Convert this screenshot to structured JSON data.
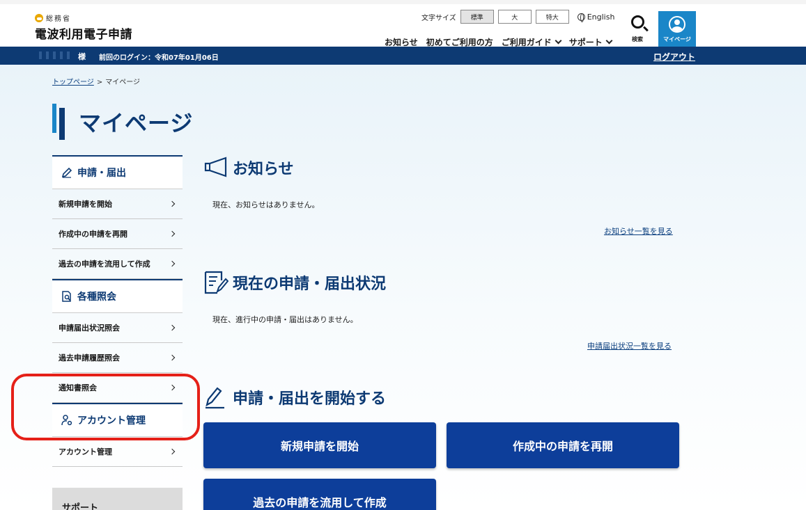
{
  "header": {
    "logo_small": "総務省",
    "logo_title": "電波利用電子申請",
    "fontsize_label": "文字サイズ",
    "fontsize_options": [
      "標準",
      "大",
      "特大"
    ],
    "language": "English",
    "nav": [
      "お知らせ",
      "初めてご利用の方",
      "ご利用ガイド",
      "サポート"
    ],
    "search_label": "検索",
    "mypage_label": "マイページ"
  },
  "userbar": {
    "name_suffix": "様",
    "last_login": "前回のログイン：令和07年01月06日",
    "logout": "ログアウト"
  },
  "breadcrumb": {
    "home": "トップページ",
    "separator": ">",
    "current": "マイページ"
  },
  "page_title": "マイページ",
  "sidebar": {
    "apply_head": "申請・届出",
    "apply_items": [
      "新規申請を開始",
      "作成中の申請を再開",
      "過去の申請を流用して作成"
    ],
    "inquiry_head": "各種照会",
    "inquiry_items": [
      "申請届出状況照会",
      "過去申請履歴照会",
      "通知書照会"
    ],
    "account_head": "アカウント管理",
    "account_items": [
      "アカウント管理"
    ],
    "support": "サポート"
  },
  "notice": {
    "title": "お知らせ",
    "text": "現在、お知らせはありません。",
    "link": "お知らせ一覧を見る"
  },
  "status": {
    "title": "現在の申請・届出状況",
    "text": "現在、進行中の申請・届出はありません。",
    "link": "申請届出状況一覧を見る"
  },
  "start": {
    "title": "申請・届出を開始する",
    "buttons": [
      "新規申請を開始",
      "作成中の申請を再開",
      "過去の申請を流用して作成"
    ]
  },
  "colors": {
    "navy": "#0d3a73",
    "accent_blue": "#1a86c8",
    "button_blue": "#0d3e9a",
    "highlight_red": "#e52018"
  }
}
